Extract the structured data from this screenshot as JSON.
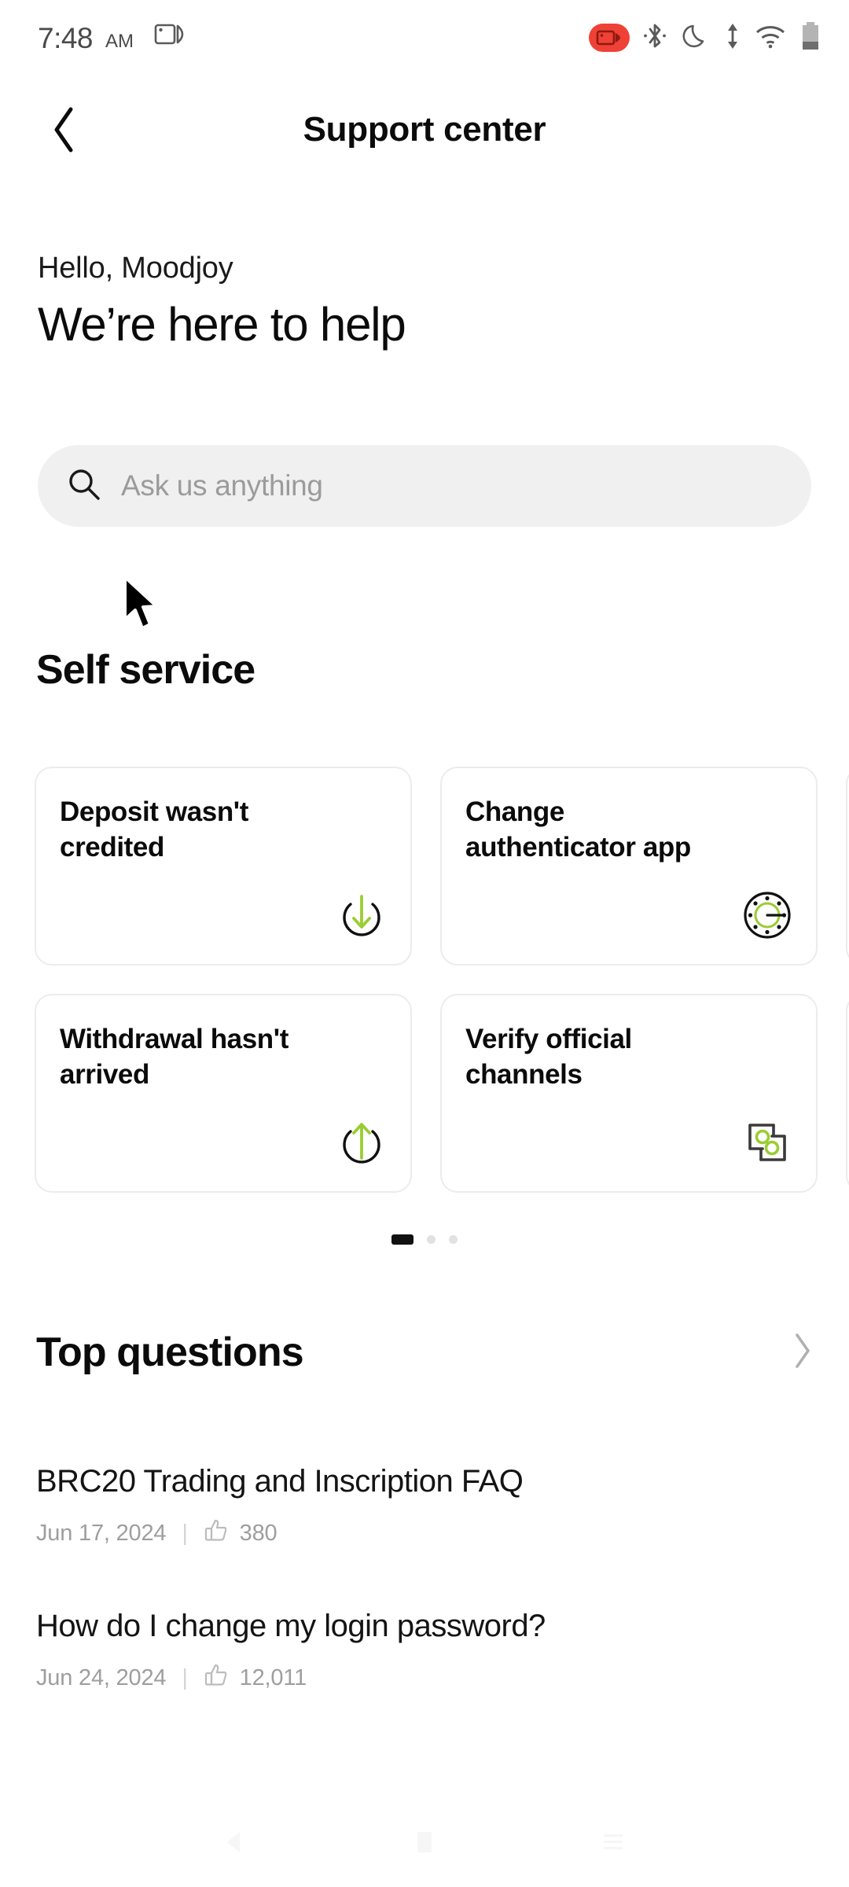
{
  "status_bar": {
    "time": "7:48",
    "ampm": "AM",
    "icons": [
      "screen-cast-icon",
      "screen-record-icon",
      "bluetooth-icon",
      "do-not-disturb-moon-icon",
      "data-transfer-icon",
      "wifi-icon",
      "battery-icon"
    ],
    "record_badge_color": "#ef4136"
  },
  "header": {
    "back_label": "Back",
    "title": "Support center"
  },
  "greeting": {
    "hello": "Hello, Moodjoy",
    "headline": "We’re here to help"
  },
  "search": {
    "placeholder": "Ask us anything",
    "value": ""
  },
  "self_service": {
    "title": "Self service",
    "cards": [
      {
        "label": "Deposit wasn't credited",
        "icon": "arrow-down-circle-icon"
      },
      {
        "label": "Change authenticator app",
        "icon": "authenticator-dial-icon"
      },
      {
        "label": "Withdrawal hasn't arrived",
        "icon": "arrow-up-circle-icon"
      },
      {
        "label": "Verify official channels",
        "icon": "linked-screens-icon"
      }
    ],
    "pagination": {
      "total": 3,
      "active": 1
    }
  },
  "top_questions": {
    "title": "Top questions",
    "chevron": "chevron-right-icon",
    "items": [
      {
        "title": "BRC20 Trading and Inscription FAQ",
        "date": "Jun 17, 2024",
        "separator": "|",
        "likes": "380"
      },
      {
        "title": "How do I change my login password?",
        "date": "Jun 24, 2024",
        "separator": "|",
        "likes": "12,011"
      }
    ]
  },
  "nav_bar": {
    "items": [
      "back-nav-icon",
      "home-nav-icon",
      "recents-nav-icon"
    ]
  },
  "theme": {
    "accent_green": "#9ACD32",
    "search_bg": "#f0f0f0",
    "card_border": "#ececec"
  }
}
